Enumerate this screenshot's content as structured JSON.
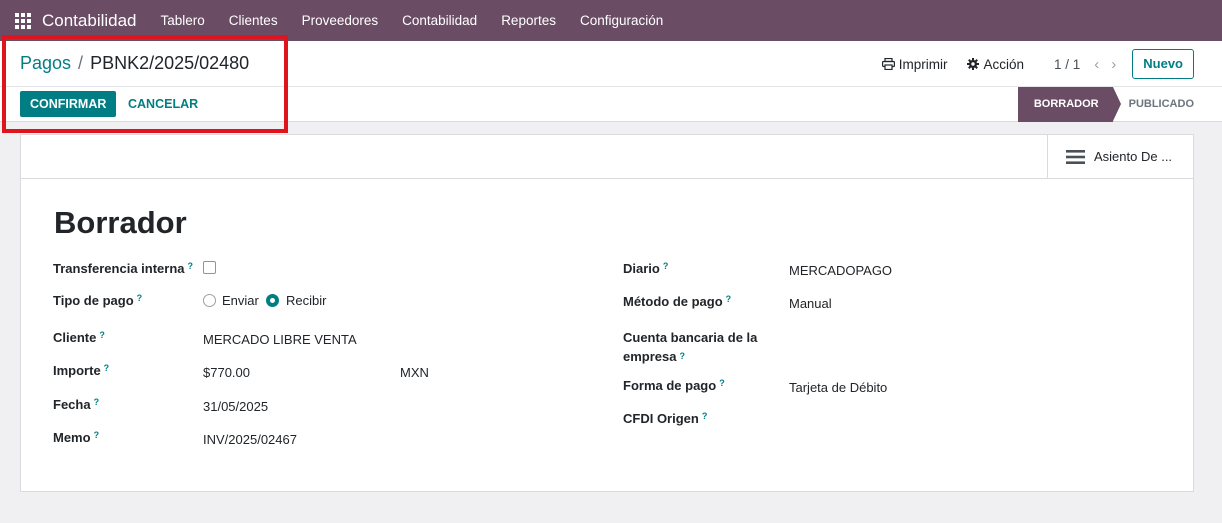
{
  "navbar": {
    "app_name": "Contabilidad",
    "items": [
      "Tablero",
      "Clientes",
      "Proveedores",
      "Contabilidad",
      "Reportes",
      "Configuración"
    ]
  },
  "breadcrumb": {
    "parent": "Pagos",
    "separator": "/",
    "current": "PBNK2/2025/02480"
  },
  "actions": {
    "print": "Imprimir",
    "action": "Acción",
    "pager": "1 / 1",
    "new": "Nuevo"
  },
  "buttons": {
    "confirm": "CONFIRMAR",
    "cancel": "CANCELAR"
  },
  "statusbar": {
    "active": "BORRADOR",
    "next": "PUBLICADO"
  },
  "smart_button": {
    "label": "Asiento De ..."
  },
  "form": {
    "title": "Borrador",
    "help_mark": "?",
    "left": {
      "transfer_label": "Transferencia interna",
      "payment_type_label": "Tipo de pago",
      "payment_type_send": "Enviar",
      "payment_type_receive": "Recibir",
      "customer_label": "Cliente",
      "customer_value": "MERCADO LIBRE VENTA",
      "amount_label": "Importe",
      "amount_value": "$770.00",
      "currency_value": "MXN",
      "date_label": "Fecha",
      "date_value": "31/05/2025",
      "memo_label": "Memo",
      "memo_value": "INV/2025/02467"
    },
    "right": {
      "journal_label": "Diario",
      "journal_value": "MERCADOPAGO",
      "method_label": "Método de pago",
      "method_value": "Manual",
      "bank_label_line1": "Cuenta bancaria de la",
      "bank_label_line2": "empresa",
      "payment_form_label": "Forma de pago",
      "payment_form_value": "Tarjeta de Débito",
      "cfdi_label": "CFDI Origen"
    }
  },
  "colors": {
    "navbar": "#6b4c65",
    "primary": "#017e84",
    "highlight": "#e0141c"
  }
}
